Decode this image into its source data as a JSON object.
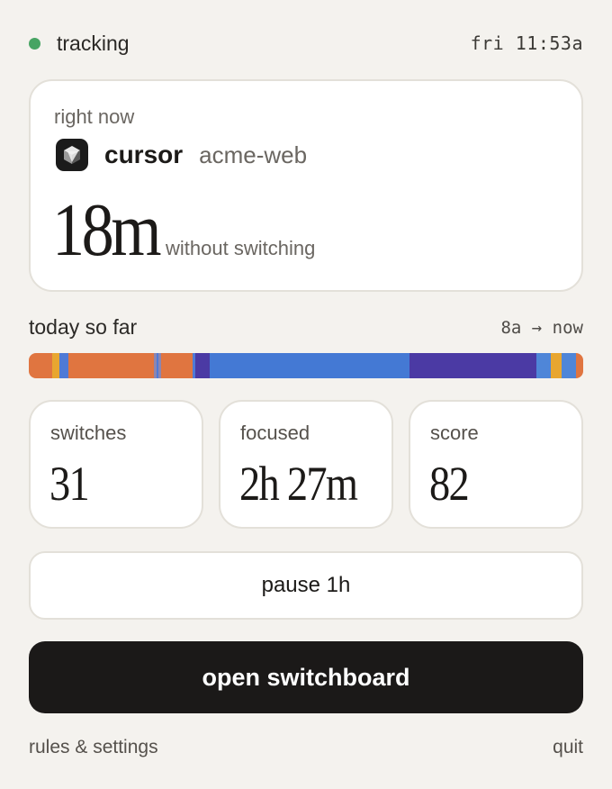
{
  "status": {
    "label": "tracking",
    "time": "fri 11:53a",
    "dot_color": "#47a463"
  },
  "now": {
    "caption": "right now",
    "app": "cursor",
    "project": "acme-web",
    "duration": "18m",
    "duration_note": "without switching"
  },
  "today": {
    "label": "today so far",
    "range": "8a → now",
    "segments": [
      {
        "color": "#e07540",
        "share": 0.043
      },
      {
        "color": "#e8a630",
        "share": 0.013
      },
      {
        "color": "#4f7ad6",
        "share": 0.016
      },
      {
        "color": "#e07540",
        "share": 0.154
      },
      {
        "color": "#8c86b0",
        "share": 0.004
      },
      {
        "color": "#4f7ad6",
        "share": 0.004
      },
      {
        "color": "#8c86b0",
        "share": 0.004
      },
      {
        "color": "#e07540",
        "share": 0.057
      },
      {
        "color": "#4f7ad6",
        "share": 0.005
      },
      {
        "color": "#4b3aa4",
        "share": 0.026
      },
      {
        "color": "#4479d4",
        "share": 0.36
      },
      {
        "color": "#4b3aa4",
        "share": 0.229
      },
      {
        "color": "#4f86d8",
        "share": 0.026
      },
      {
        "color": "#e8a630",
        "share": 0.02
      },
      {
        "color": "#4f86d8",
        "share": 0.026
      },
      {
        "color": "#e07540",
        "share": 0.013
      }
    ]
  },
  "stats": [
    {
      "label": "switches",
      "value": "31"
    },
    {
      "label": "focused",
      "value": "2h 27m"
    },
    {
      "label": "score",
      "value": "82"
    }
  ],
  "actions": {
    "pause": "pause 1h",
    "open": "open switchboard"
  },
  "footer": {
    "settings": "rules & settings",
    "quit": "quit"
  }
}
